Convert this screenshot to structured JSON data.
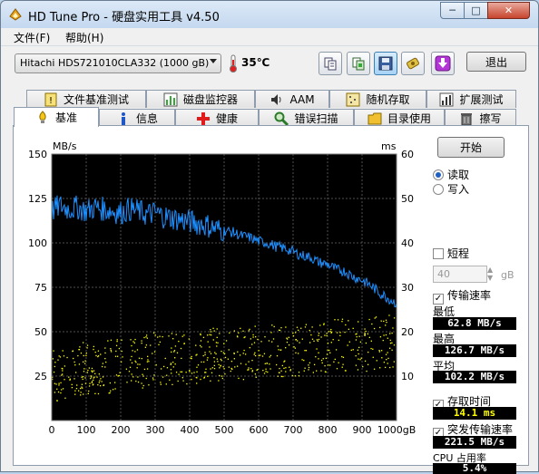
{
  "window": {
    "title": "HD Tune Pro - 硬盘实用工具 v4.50"
  },
  "menu": {
    "items": [
      "文件(F)",
      "帮助(H)"
    ]
  },
  "toolbar": {
    "drive": "Hitachi HDS721010CLA332 (1000 gB)",
    "temperature": "35℃",
    "exit_label": "退出",
    "icons": [
      "copy-info-icon",
      "copy-screenshot-icon",
      "save-icon",
      "options-icon",
      "download-icon"
    ]
  },
  "tabs_top": [
    {
      "label": "文件基准测试",
      "icon": "file-benchmark-icon"
    },
    {
      "label": "磁盘监控器",
      "icon": "disk-monitor-icon"
    },
    {
      "label": "AAM",
      "icon": "speaker-icon"
    },
    {
      "label": "随机存取",
      "icon": "random-access-icon"
    },
    {
      "label": "扩展测试",
      "icon": "extra-tests-icon"
    }
  ],
  "tabs_bottom": [
    {
      "label": "基准",
      "icon": "benchmark-icon",
      "selected": true
    },
    {
      "label": "信息",
      "icon": "info-icon",
      "selected": false
    },
    {
      "label": "健康",
      "icon": "health-icon",
      "selected": false
    },
    {
      "label": "错误扫描",
      "icon": "error-scan-icon",
      "selected": false
    },
    {
      "label": "目录使用",
      "icon": "folder-usage-icon",
      "selected": false
    },
    {
      "label": "擦写",
      "icon": "erase-icon",
      "selected": false
    }
  ],
  "panel": {
    "start_label": "开始",
    "read_label": "读取",
    "write_label": "写入",
    "mode_selected": "read",
    "short_label": "短程",
    "short_checked": false,
    "short_value": "40",
    "short_unit": "gB",
    "transfer_rate_label": "传输速率",
    "transfer_rate_checked": true,
    "min_label": "最低",
    "min_value": "62.8 MB/s",
    "max_label": "最高",
    "max_value": "126.7 MB/s",
    "avg_label": "平均",
    "avg_value": "102.2 MB/s",
    "access_time_label": "存取时间",
    "access_time_checked": true,
    "access_time_value": "14.1 ms",
    "burst_label": "突发传输速率",
    "burst_checked": true,
    "burst_value": "221.5 MB/s",
    "cpu_label": "CPU 占用率",
    "cpu_value": "5.4%"
  },
  "chart_data": {
    "type": "line",
    "xlabel_unit": "gB",
    "ylabel_left": "MB/s",
    "ylabel_right": "ms",
    "x_ticks": [
      "0",
      "100",
      "200",
      "300",
      "400",
      "500",
      "600",
      "700",
      "800",
      "900",
      "1000gB"
    ],
    "y_left_ticks": [
      "150",
      "125",
      "100",
      "75",
      "50",
      "25"
    ],
    "y_right_ticks": [
      "60",
      "50",
      "40",
      "30",
      "20",
      "10"
    ],
    "xlim": [
      0,
      1000
    ],
    "ylim_left": [
      0,
      150
    ],
    "ylim_right": [
      0,
      60
    ],
    "grid": true,
    "colors": {
      "transfer": "#1e90ff",
      "access": "#ffff00",
      "background": "#000000",
      "grid": "#505050"
    },
    "series": [
      {
        "name": "传输速率",
        "axis": "left",
        "x": [
          0,
          25,
          50,
          75,
          100,
          125,
          150,
          175,
          200,
          225,
          250,
          275,
          300,
          325,
          350,
          375,
          400,
          425,
          450,
          475,
          500,
          525,
          550,
          575,
          600,
          625,
          650,
          675,
          700,
          725,
          750,
          775,
          800,
          825,
          850,
          875,
          900,
          925,
          950,
          975,
          1000
        ],
        "values": [
          118,
          121,
          119,
          120,
          118,
          120,
          119,
          118,
          117,
          119,
          118,
          116,
          117,
          115,
          114,
          113,
          112,
          111,
          110,
          108,
          107,
          106,
          104,
          103,
          101,
          100,
          98,
          97,
          95,
          93,
          92,
          89,
          88,
          85,
          84,
          81,
          79,
          76,
          72,
          69,
          66
        ]
      },
      {
        "name": "存取时间",
        "axis": "right",
        "x": [
          0,
          50,
          100,
          150,
          200,
          250,
          300,
          350,
          400,
          450,
          500,
          550,
          600,
          650,
          700,
          750,
          800,
          850,
          900,
          950,
          1000
        ],
        "values": [
          10,
          11,
          12,
          12,
          13,
          13,
          14,
          14,
          14,
          15,
          15,
          15,
          16,
          16,
          16,
          16,
          17,
          17,
          17,
          18,
          18
        ]
      }
    ]
  }
}
